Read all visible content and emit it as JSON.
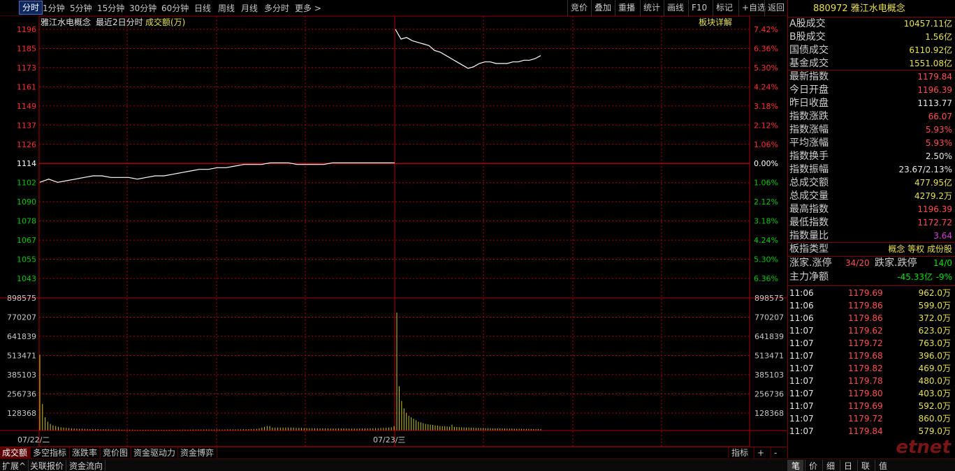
{
  "toolbar": {
    "periods": [
      "分时",
      "1分钟",
      "5分钟",
      "15分钟",
      "30分钟",
      "60分钟",
      "日线",
      "周线",
      "月线",
      "多分时",
      "更多 >"
    ],
    "actions": [
      "竞价",
      "叠加",
      "重播",
      "统计",
      "画线",
      "F10",
      "标记",
      "+自选",
      "返回"
    ]
  },
  "chart": {
    "header_name": "雅江水电概念",
    "header_range": "最近2日分时",
    "header_metric": "成交额(万)",
    "sector_detail": "板块详解",
    "price_labels": [
      "1196",
      "1185",
      "1173",
      "1161",
      "1149",
      "1137",
      "1126",
      "1114",
      "1102",
      "1090",
      "1078",
      "1067",
      "1055",
      "1043"
    ],
    "pct_labels": [
      "7.42%",
      "6.36%",
      "5.30%",
      "4.24%",
      "3.18%",
      "2.12%",
      "1.06%",
      "0.00%",
      "1.06%",
      "2.12%",
      "3.18%",
      "4.24%",
      "5.30%",
      "6.36%"
    ],
    "vol_labels": [
      "898575",
      "770207",
      "641839",
      "513471",
      "385103",
      "256736",
      "128368"
    ],
    "dates": [
      "07/22/二",
      "07/23/三"
    ],
    "colors": {
      "up": "#ff3030",
      "down": "#00c800",
      "flat": "#ffffff",
      "grid": "#b00000",
      "vol": "#c8c820"
    }
  },
  "chart_data": {
    "type": "line",
    "series": [
      {
        "values": [
          1102,
          1104,
          1102,
          1103,
          1104,
          1105,
          1106,
          1106,
          1105,
          1105,
          1105,
          1104,
          1105,
          1106,
          1106,
          1107,
          1108,
          1109,
          1110,
          1110,
          1111,
          1111,
          1112,
          1113,
          1113,
          1113,
          1114,
          1114,
          1114,
          1113,
          1113,
          1113,
          1113,
          1114,
          1114,
          1114,
          1114,
          1114,
          1114,
          1114,
          1114
        ]
      },
      {
        "values": [
          1196,
          1190,
          1191,
          1189,
          1188,
          1187,
          1186,
          1183,
          1182,
          1180,
          1178,
          1176,
          1174,
          1172,
          1173,
          1175,
          1176,
          1176,
          1175,
          1175,
          1175,
          1176,
          1176,
          1177,
          1177,
          1178,
          1179.84
        ]
      }
    ],
    "ylim": [
      1043,
      1196
    ],
    "volume": [
      513471,
      180000,
      90000,
      60000,
      45000,
      35000,
      30000,
      25000,
      22000,
      20000,
      18000,
      17000,
      15000,
      14000,
      13000,
      12000,
      12000,
      11000,
      10000,
      10000,
      9000,
      9000,
      9000,
      8000,
      8000,
      8000,
      8000,
      7000,
      7000,
      7000,
      7000,
      6000,
      6000,
      6000,
      6000,
      6000,
      5000,
      5000,
      5000,
      5000,
      5000,
      5000,
      5000,
      5000,
      5000,
      5000,
      5000,
      5000,
      5000,
      5000,
      5000,
      5000,
      5000,
      6000,
      6000,
      6000,
      6000,
      6000,
      7000,
      7000,
      7000,
      7000,
      7000,
      7000,
      7000,
      7000,
      7000,
      7000,
      7000,
      7000,
      7000,
      8000,
      8000,
      8000,
      8000,
      8000,
      8000,
      9000,
      9000,
      9000,
      10000,
      10000,
      12000,
      15000,
      20000,
      25000,
      30000,
      30000,
      20000,
      20000,
      20000,
      20000,
      20000,
      20000,
      20000,
      20000,
      20000,
      18000,
      18000,
      18000,
      16000,
      16000,
      16000,
      16000,
      16000,
      15000,
      15000,
      15000,
      15000,
      15000,
      14000,
      14000,
      14000,
      14000,
      14000,
      14000,
      14000,
      13000,
      13000,
      13000,
      13000,
      14000,
      14000,
      14000,
      15000,
      15000,
      15000,
      16000,
      16000,
      17000,
      18000,
      19000,
      20000,
      22000,
      30000
    ],
    "volume2": [
      800000,
      300000,
      200000,
      150000,
      120000,
      100000,
      90000,
      80000,
      70000,
      60000,
      55000,
      50000,
      45000,
      42000,
      40000,
      38000,
      35000,
      33000,
      30000,
      29000,
      28000,
      27000,
      26000,
      40000,
      25000,
      24000,
      23000,
      22000,
      21000,
      20000,
      20000,
      19000,
      19000,
      18000,
      18000,
      17000,
      17000,
      16000,
      16000,
      16000,
      15000,
      15000,
      15000,
      14000,
      14000,
      14000,
      13000,
      13000,
      13000,
      12000,
      12000,
      12000,
      12000,
      11000,
      11000,
      11000,
      11000,
      10000,
      10000,
      10000,
      10000
    ]
  },
  "bottom_tabs": [
    "成交额",
    "多空指标",
    "涨跌率",
    "竞价图",
    "资金驱动力",
    "资金博弈"
  ],
  "bottom_right": [
    "指标",
    "+",
    "-"
  ],
  "statusbar": [
    "扩展^",
    "关联报价",
    "资金流向"
  ],
  "right_tabs": [
    "笔",
    "价",
    "细",
    "日",
    "联",
    "值"
  ],
  "panel": {
    "code": "880972",
    "name": "雅江水电概念",
    "rows": [
      {
        "label": "A股成交",
        "value": "10457.11亿",
        "cls": "y"
      },
      {
        "label": "B股成交",
        "value": "1.56亿",
        "cls": "y"
      },
      {
        "label": "国债成交",
        "value": "6110.92亿",
        "cls": "y"
      },
      {
        "label": "基金成交",
        "value": "1551.08亿",
        "cls": "y"
      },
      {
        "label": "最新指数",
        "value": "1179.84",
        "cls": "r"
      },
      {
        "label": "今日开盘",
        "value": "1196.39",
        "cls": "r"
      },
      {
        "label": "昨日收盘",
        "value": "1113.77",
        "cls": "w"
      },
      {
        "label": "指数涨跌",
        "value": "66.07",
        "cls": "r"
      },
      {
        "label": "指数涨幅",
        "value": "5.93%",
        "cls": "r"
      },
      {
        "label": "平均涨幅",
        "value": "5.93%",
        "cls": "r"
      },
      {
        "label": "指数换手",
        "value": "2.50%",
        "cls": "w"
      },
      {
        "label": "指数振幅",
        "value": "23.67/2.13%",
        "cls": "w"
      },
      {
        "label": "总成交额",
        "value": "477.95亿",
        "cls": "y"
      },
      {
        "label": "总成交量",
        "value": "4279.2万",
        "cls": "y"
      },
      {
        "label": "最高指数",
        "value": "1196.39",
        "cls": "r"
      },
      {
        "label": "最低指数",
        "value": "1172.72",
        "cls": "r"
      },
      {
        "label": "指数量比",
        "value": "3.64",
        "cls": "m"
      }
    ],
    "type_label": "板指类型",
    "type_value": "概念 等权 成份股",
    "rise_label": "涨家.涨停",
    "rise_value": "34/20",
    "fall_label": "跌家.跌停",
    "fall_value": "14/0",
    "net_label": "主力净额",
    "net_value": "-45.33亿",
    "net_pct": "-9%",
    "ticks": [
      {
        "t": "11:06",
        "p": "1179.69",
        "v": "962.0万"
      },
      {
        "t": "11:06",
        "p": "1179.86",
        "v": "599.0万"
      },
      {
        "t": "11:06",
        "p": "1179.86",
        "v": "372.0万"
      },
      {
        "t": "11:07",
        "p": "1179.62",
        "v": "623.0万"
      },
      {
        "t": "11:07",
        "p": "1179.72",
        "v": "763.0万"
      },
      {
        "t": "11:07",
        "p": "1179.68",
        "v": "396.0万"
      },
      {
        "t": "11:07",
        "p": "1179.82",
        "v": "469.0万"
      },
      {
        "t": "11:07",
        "p": "1179.78",
        "v": "480.0万"
      },
      {
        "t": "11:07",
        "p": "1179.80",
        "v": "403.0万"
      },
      {
        "t": "11:07",
        "p": "1179.69",
        "v": "592.0万"
      },
      {
        "t": "11:07",
        "p": "1179.72",
        "v": "860.0万"
      },
      {
        "t": "11:07",
        "p": "1179.84",
        "v": "579.0万"
      }
    ]
  },
  "watermark": "etnet"
}
